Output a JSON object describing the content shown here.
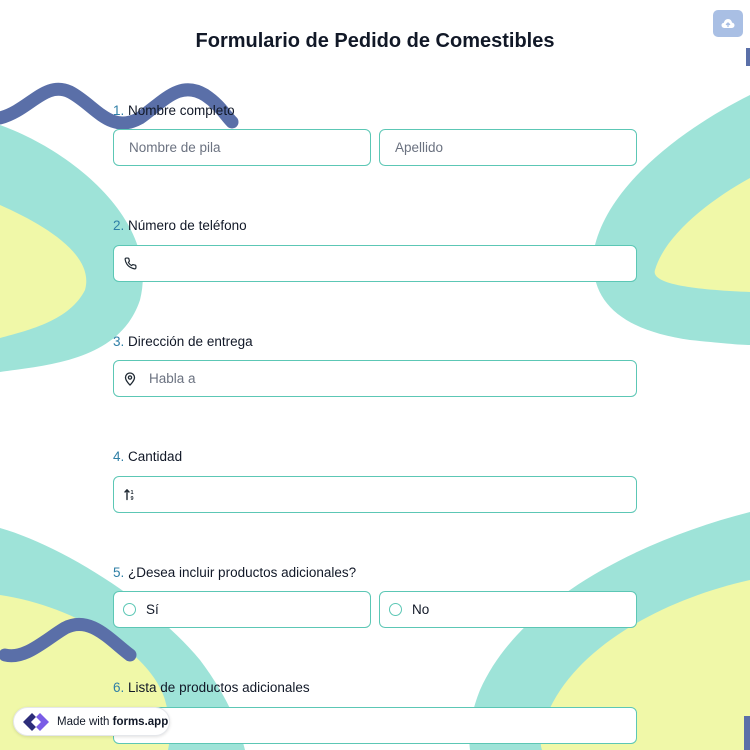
{
  "form": {
    "title": "Formulario de Pedido de Comestibles",
    "upload_icon": "cloud-upload-icon"
  },
  "questions": [
    {
      "number": "1.",
      "label": "Nombre completo",
      "fields": [
        {
          "placeholder": "Nombre de pila"
        },
        {
          "placeholder": "Apellido"
        }
      ]
    },
    {
      "number": "2.",
      "label": "Número de teléfono",
      "icon": "phone-icon",
      "placeholder": ""
    },
    {
      "number": "3.",
      "label": "Dirección de entrega",
      "icon": "location-pin-icon",
      "placeholder": "Habla a"
    },
    {
      "number": "4.",
      "label": "Cantidad",
      "icon": "number-sort-icon",
      "placeholder": ""
    },
    {
      "number": "5.",
      "label": "¿Desea incluir productos adicionales?",
      "options": [
        "Sí",
        "No"
      ]
    },
    {
      "number": "6.",
      "label": "Lista de productos adicionales"
    }
  ],
  "badge": {
    "prefix": "Made with",
    "brand": "forms.app"
  },
  "colors": {
    "accent_border": "#5cc7b5",
    "number_color": "#2f7fa6",
    "wave_navy": "#5a6fa8",
    "blob_teal": "#9ee3d8",
    "blob_yellow": "#f0f8a8"
  }
}
